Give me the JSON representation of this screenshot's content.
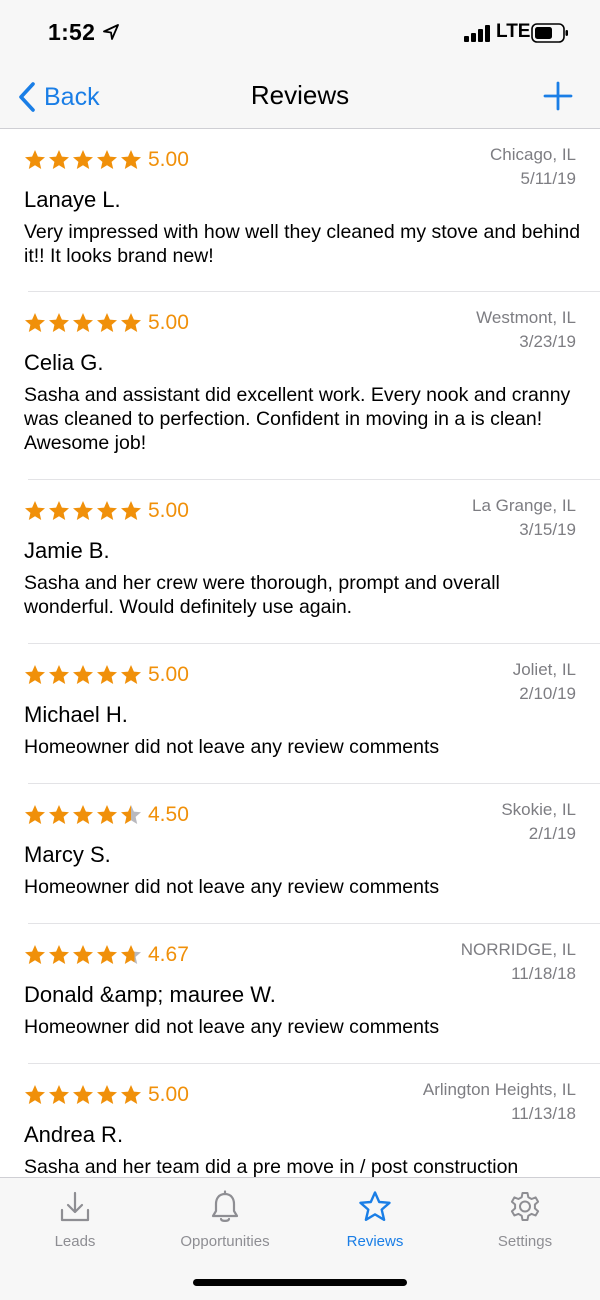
{
  "status_bar": {
    "time": "1:52",
    "network": "LTE"
  },
  "nav": {
    "back_label": "Back",
    "title": "Reviews"
  },
  "colors": {
    "accent": "#1a7ee6",
    "star": "#f0900a",
    "muted": "#7d7d82"
  },
  "reviews": [
    {
      "rating": 5.0,
      "rating_text": "5.00",
      "location": "Chicago, IL",
      "date": "5/11/19",
      "name": "Lanaye L.",
      "comment": "Very impressed with how well they cleaned my stove and behind it!! It looks brand new!"
    },
    {
      "rating": 5.0,
      "rating_text": "5.00",
      "location": "Westmont, IL",
      "date": "3/23/19",
      "name": "Celia G.",
      "comment": "Sasha and assistant did excellent work. Every nook and cranny was cleaned to perfection. Confident in moving in a is clean! Awesome job!"
    },
    {
      "rating": 5.0,
      "rating_text": "5.00",
      "location": "La Grange, IL",
      "date": "3/15/19",
      "name": "Jamie B.",
      "comment": "Sasha and her crew were thorough, prompt and overall wonderful. Would definitely use again."
    },
    {
      "rating": 5.0,
      "rating_text": "5.00",
      "location": "Joliet, IL",
      "date": "2/10/19",
      "name": "Michael H.",
      "comment": "Homeowner did not leave any review comments"
    },
    {
      "rating": 4.5,
      "rating_text": "4.50",
      "location": "Skokie, IL",
      "date": "2/1/19",
      "name": "Marcy S.",
      "comment": "Homeowner did not leave any review comments"
    },
    {
      "rating": 4.67,
      "rating_text": "4.67",
      "location": "NORRIDGE, IL",
      "date": "11/18/18",
      "name": "Donald &amp; mauree W.",
      "comment": "Homeowner did not leave any review comments"
    },
    {
      "rating": 5.0,
      "rating_text": "5.00",
      "location": "Arlington Heights, IL",
      "date": "11/13/18",
      "name": "Andrea R.",
      "comment": "Sasha and her team did a pre move in / post construction"
    }
  ],
  "tabs": [
    {
      "label": "Leads",
      "icon": "download-tray-icon",
      "active": false
    },
    {
      "label": "Opportunities",
      "icon": "bell-icon",
      "active": false
    },
    {
      "label": "Reviews",
      "icon": "star-icon",
      "active": true
    },
    {
      "label": "Settings",
      "icon": "gear-icon",
      "active": false
    }
  ]
}
